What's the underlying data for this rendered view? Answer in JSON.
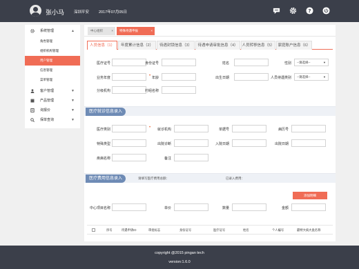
{
  "header": {
    "username": "张小马",
    "company": "深圳平安",
    "date": "2017年07月05日",
    "icons": [
      "chat-icon",
      "gear-icon",
      "help-icon",
      "power-icon"
    ]
  },
  "sidebar": {
    "groups": [
      {
        "label": "系统管理",
        "icon": "gear-icon"
      },
      {
        "label": "客户管理",
        "icon": "user-icon"
      },
      {
        "label": "产品管理",
        "icon": "box-icon"
      },
      {
        "label": "询报价",
        "icon": "quote-icon"
      },
      {
        "label": "保单查询",
        "icon": "search-icon"
      }
    ],
    "sub_items": [
      "角色管理",
      "组织机构管理",
      "用户管理",
      "信息管理",
      "菜单管理"
    ],
    "active_sub": "用户管理"
  },
  "page_tabs": [
    {
      "label": "中心组织",
      "close": "×"
    },
    {
      "label": "特殊待遇申报",
      "close": "×"
    }
  ],
  "info_tabs": [
    "人员信息（1）",
    "年度累计信息（2）",
    "待遇封锁信息（3）",
    "待遇申请审批信息（4）",
    "人员转移信息（5）",
    "家庭账户信息（6）"
  ],
  "person_form": {
    "medical_no": "医疗证号",
    "id_no": "身份证号",
    "name": "姓名",
    "gender": "性别",
    "biz_year": "业务年度",
    "age": "年龄",
    "birth_date": "出生日期",
    "person_type": "人员待遇类别",
    "branch": "分级机构",
    "village": "村组名称",
    "select_placeholder": "--请选择--"
  },
  "section1": {
    "title": "医疗就诊信息录入",
    "fields": {
      "med_type": "医疗类别",
      "hospital": "就诊机构",
      "doc_no": "单据号",
      "bed_no": "病历号",
      "special": "特殊类型",
      "diagnosis": "出院诊断",
      "in_date": "入院日期",
      "out_date": "出院日期",
      "disease": "疾病名称",
      "remark": "备注"
    }
  },
  "section2": {
    "title": "医疗费用信息录入",
    "note1": "请填写医疗费用总额：",
    "note2": "已录入费用：",
    "add_button": "添加明细",
    "fields": {
      "item_name": "中心项目名称",
      "price": "单价",
      "qty": "数量",
      "amount": "金额"
    }
  },
  "table": {
    "headers": [
      "序号",
      "待遇申请ID",
      "审批标志",
      "身份证号",
      "医疗证号",
      "姓名",
      "个人编号",
      "最特大病大类名称"
    ]
  },
  "footer": {
    "copyright": "copyright @2015 pingan tech",
    "version": "version:1.6.0"
  }
}
